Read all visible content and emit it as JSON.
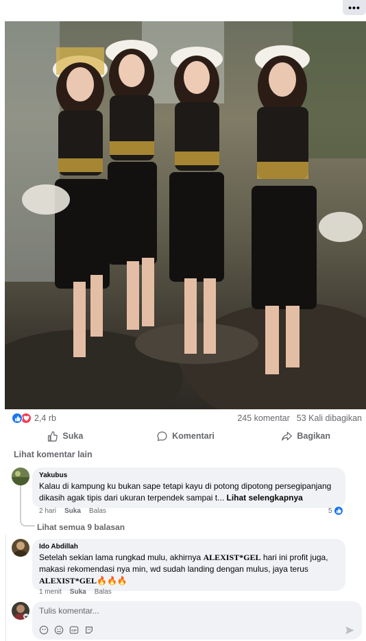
{
  "post": {
    "menu_label": "•••",
    "reactions": {
      "count": "2,4 rb",
      "types": [
        "like-icon",
        "love-icon"
      ]
    },
    "comment_count": "245 komentar",
    "share_count": "53 Kali dibagikan",
    "actions": {
      "like": "Suka",
      "comment": "Komentari",
      "share": "Bagikan"
    }
  },
  "comments": {
    "more_label": "Lihat komentar lain",
    "items": [
      {
        "author": "Yakubus",
        "text": "Kalau di kampung ku bukan sape tetapi kayu di potong dipotong persegipanjang dikasih agak tipis dari ukuran terpendek sampai t... ",
        "see_more": "Lihat selengkapnya",
        "time": "2 hari",
        "like": "Suka",
        "reply": "Balas",
        "reaction_count": "5"
      },
      {
        "author": "Ido Abdillah",
        "text_1": "Setelah sekian lama rungkad mulu, akhirnya ",
        "brand_1": "ALEXIST*GEL",
        "text_2": " hari ini profit juga, makasi rekomendasi nya min, wd sudah landing dengan mulus, jaya terus ",
        "brand_2": "ALEXIST*GEL",
        "emojis": "🔥🔥🔥",
        "time": "1 menit",
        "like": "Suka",
        "reply": "Balas"
      }
    ],
    "see_replies": "Lihat semua 9 balasan"
  },
  "composer": {
    "placeholder": "Tulis komentar...",
    "tools": [
      "sticker-icon",
      "emoji-icon",
      "gif-icon",
      "avatar-sticker-icon"
    ]
  },
  "colors": {
    "accent": "#1877f2",
    "love": "#f33e58",
    "muted": "#65676b",
    "bubble": "#f0f2f5"
  }
}
